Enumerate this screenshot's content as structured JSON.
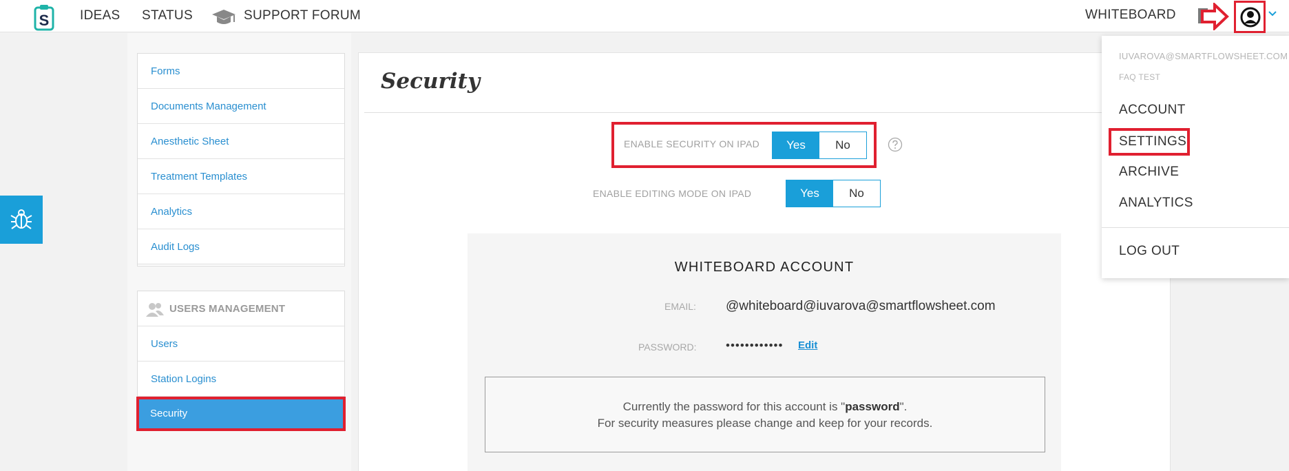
{
  "topnav": {
    "logo_letter": "S",
    "ideas": "IDEAS",
    "status": "STATUS",
    "support_forum": "SUPPORT FORUM",
    "whiteboard": "WHITEBOARD"
  },
  "sidebar": {
    "items": [
      {
        "label": "Forms"
      },
      {
        "label": "Documents Management"
      },
      {
        "label": "Anesthetic Sheet"
      },
      {
        "label": "Treatment Templates"
      },
      {
        "label": "Analytics"
      },
      {
        "label": "Audit Logs"
      }
    ],
    "users_section": {
      "heading": "USERS MANAGEMENT",
      "items": [
        {
          "label": "Users"
        },
        {
          "label": "Station Logins"
        },
        {
          "label": "Security"
        }
      ]
    }
  },
  "main": {
    "title": "Security",
    "enable_security": {
      "label": "ENABLE SECURITY ON IPAD",
      "yes": "Yes",
      "no": "No",
      "selected": "Yes"
    },
    "enable_editing": {
      "label": "ENABLE EDITING MODE ON IPAD",
      "yes": "Yes",
      "no": "No",
      "selected": "Yes"
    },
    "whiteboard_account": {
      "title": "WHITEBOARD ACCOUNT",
      "email_label": "EMAIL:",
      "email_value": "@whiteboard@iuvarova@smartflowsheet.com",
      "password_label": "PASSWORD:",
      "password_value": "••••••••••••",
      "edit_link": "Edit",
      "note_prefix": "Currently the password for this account is \"",
      "note_password": "password",
      "note_suffix": "\".",
      "note_line2": "For security measures please change and keep for your records."
    }
  },
  "dropdown": {
    "email": "IUVAROVA@SMARTFLOWSHEET.COM",
    "subtitle": "FAQ TEST",
    "account": "ACCOUNT",
    "settings": "SETTINGS",
    "archive": "ARCHIVE",
    "analytics": "ANALYTICS",
    "logout": "LOG OUT"
  },
  "colors": {
    "accent": "#1a9fd9",
    "link": "#2a8fd0",
    "highlight_red": "#e02030",
    "active_sidebar": "#3b9ee0"
  }
}
